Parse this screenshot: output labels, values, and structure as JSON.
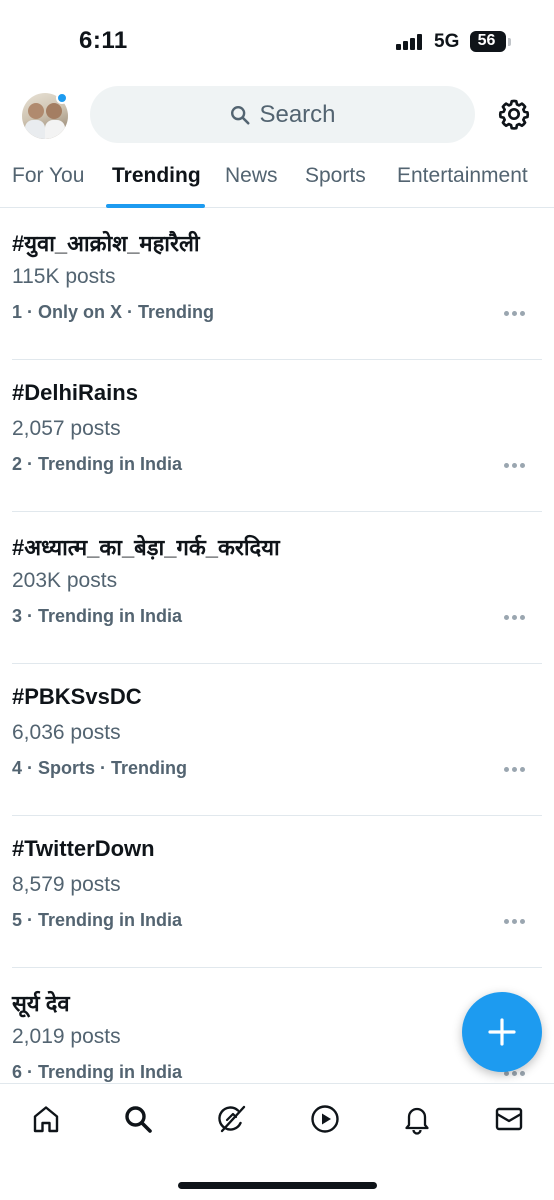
{
  "status_bar": {
    "time": "6:11",
    "network": "5G",
    "battery": "56"
  },
  "header": {
    "avatar": "profile-avatar",
    "search_placeholder": "Search",
    "settings_icon": "gear-icon",
    "notification_dot_color": "#1d9bf0"
  },
  "tabs": [
    {
      "label": "For You",
      "active": false
    },
    {
      "label": "Trending",
      "active": true
    },
    {
      "label": "News",
      "active": false
    },
    {
      "label": "Sports",
      "active": false
    },
    {
      "label": "Entertainment",
      "active": false
    }
  ],
  "trends": [
    {
      "name": "#युवा_आक्रोश_महारैली",
      "posts": "115K posts",
      "context": "1 · Only on X · Trending"
    },
    {
      "name": "#DelhiRains",
      "posts": "2,057 posts",
      "context": "2 · Trending in India"
    },
    {
      "name": "#अध्यात्म_का_बेड़ा_गर्क_करदिया",
      "posts": "203K posts",
      "context": "3 · Trending in India"
    },
    {
      "name": "#PBKSvsDC",
      "posts": "6,036 posts",
      "context": "4 · Sports · Trending"
    },
    {
      "name": "#TwitterDown",
      "posts": "8,579 posts",
      "context": "5 · Trending in India"
    },
    {
      "name": "सूर्य देव",
      "posts": "2,019 posts",
      "context": "6 · Trending in India"
    }
  ],
  "fab": {
    "icon": "plus-icon",
    "color": "#1d9bf0"
  },
  "bottom_nav": [
    {
      "icon": "home-icon",
      "active": false
    },
    {
      "icon": "search-icon",
      "active": true
    },
    {
      "icon": "grok-icon",
      "active": false
    },
    {
      "icon": "play-icon",
      "active": false
    },
    {
      "icon": "bell-icon",
      "active": false
    },
    {
      "icon": "mail-icon",
      "active": false
    }
  ],
  "colors": {
    "accent": "#1d9bf0",
    "text_primary": "#0f1419",
    "text_secondary": "#536471"
  }
}
